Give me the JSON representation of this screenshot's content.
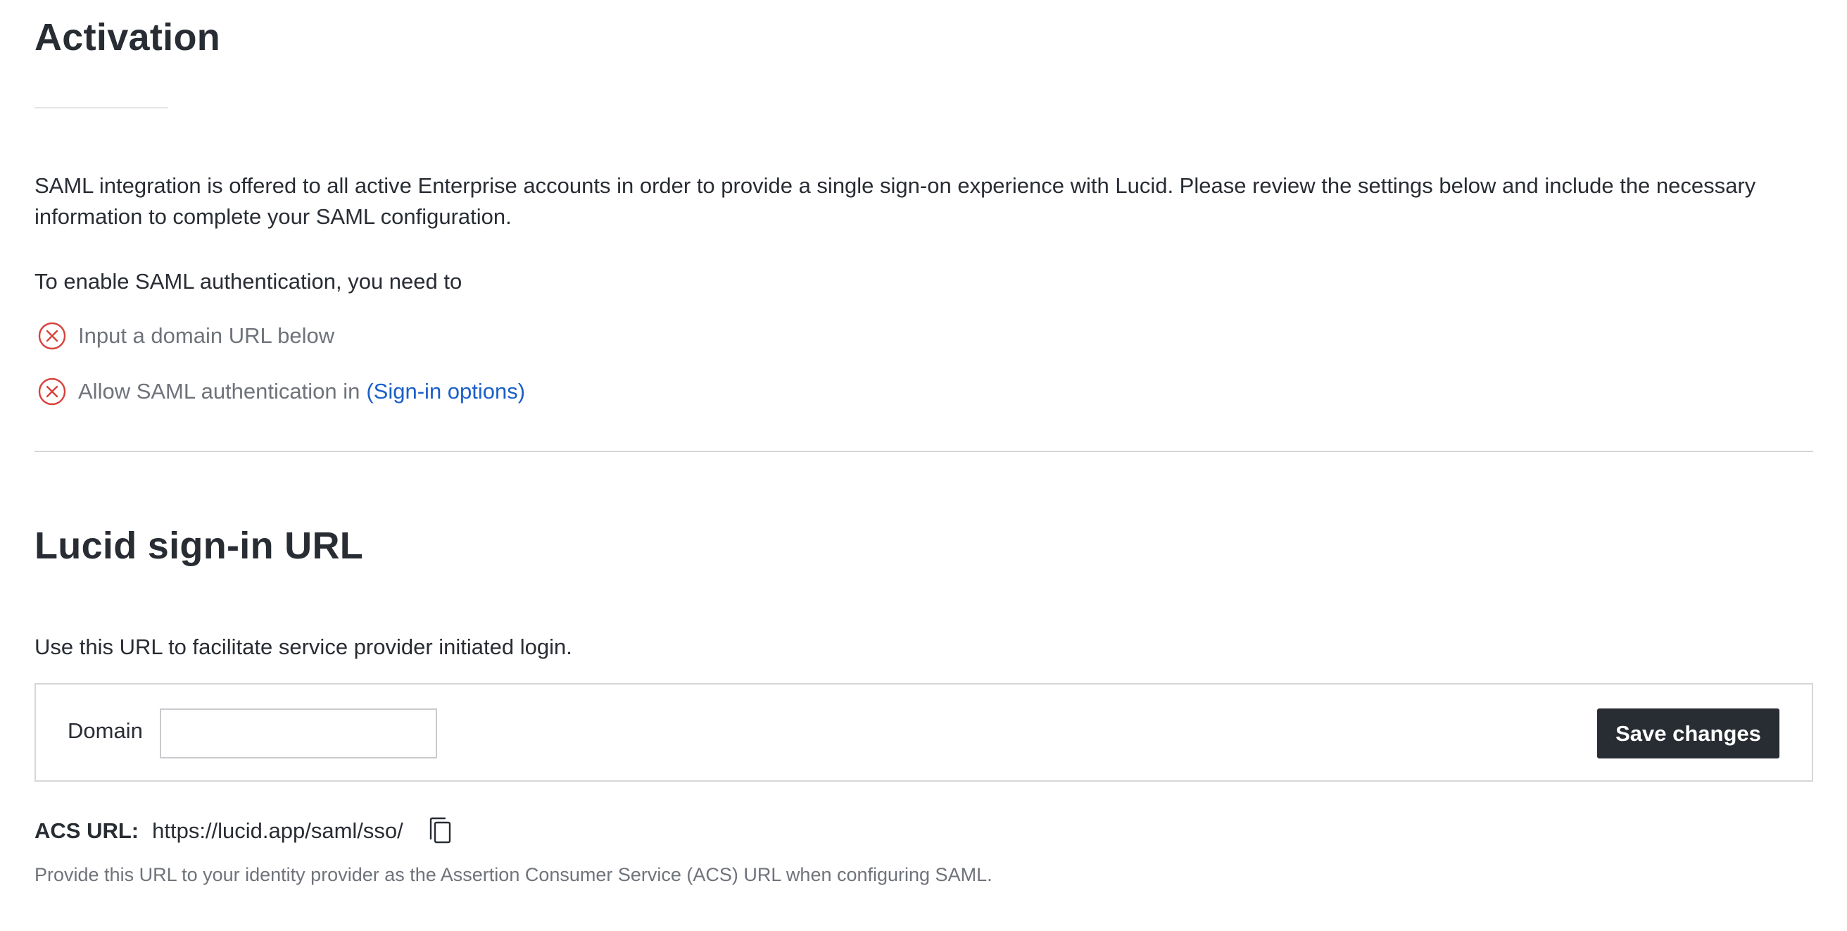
{
  "activation": {
    "title": "Activation",
    "intro": "SAML integration is offered to all active Enterprise accounts in order to provide a single sign-on experience with Lucid. Please review the settings below and include the necessary information to complete your SAML configuration.",
    "need_to": "To enable SAML authentication, you need to",
    "requirements": [
      {
        "text": "Input a domain URL below",
        "icon": "error-circle-x-icon",
        "status": "incomplete"
      },
      {
        "text": "Allow SAML authentication in",
        "link": "(Sign-in options)",
        "icon": "error-circle-x-icon",
        "status": "incomplete"
      }
    ],
    "error_color": "#d9413c",
    "link_color": "#1a5fc9"
  },
  "signin": {
    "title": "Lucid sign-in URL",
    "description": "Use this URL to facilitate service provider initiated login.",
    "domain_label": "Domain",
    "domain_value": "",
    "domain_placeholder": "",
    "save_label": "Save changes",
    "acs_label": "ACS URL:",
    "acs_value": "https://lucid.app/saml/sso/",
    "copy_icon": "copy-icon",
    "acs_help": "Provide this URL to your identity provider as the Assertion Consumer Service (ACS) URL when configuring SAML."
  },
  "colors": {
    "text": "#282c33",
    "muted": "#6f737a",
    "button_bg": "#282c33",
    "border": "#d4d6d9"
  }
}
